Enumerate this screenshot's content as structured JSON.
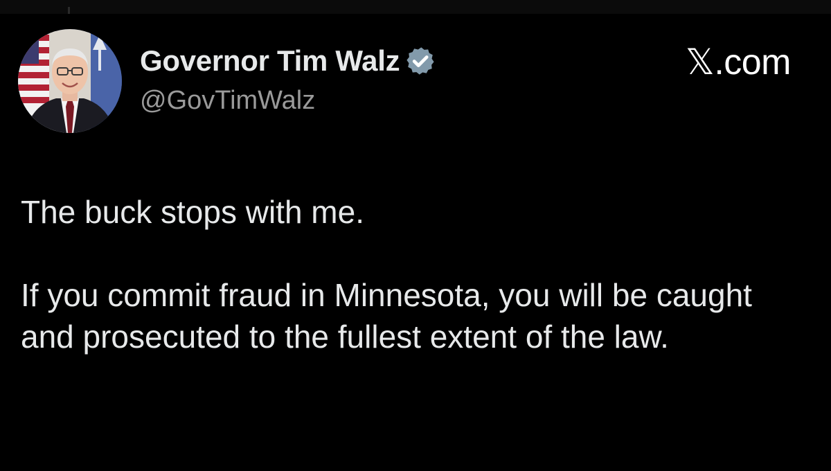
{
  "author": {
    "display_name": "Governor Tim Walz",
    "handle": "@GovTimWalz",
    "verified_icon": "verified-badge-icon",
    "badge_color": "#829aab"
  },
  "source": {
    "label": "𝕏.com"
  },
  "tweet": {
    "paragraphs": [
      "The buck stops with me.",
      "If you commit fraud in Minnesota, you will be caught and prosecuted to the fullest extent of the law."
    ]
  },
  "colors": {
    "background": "#000000",
    "text": "#e7e9ea",
    "handle": "#9a9a9a"
  }
}
